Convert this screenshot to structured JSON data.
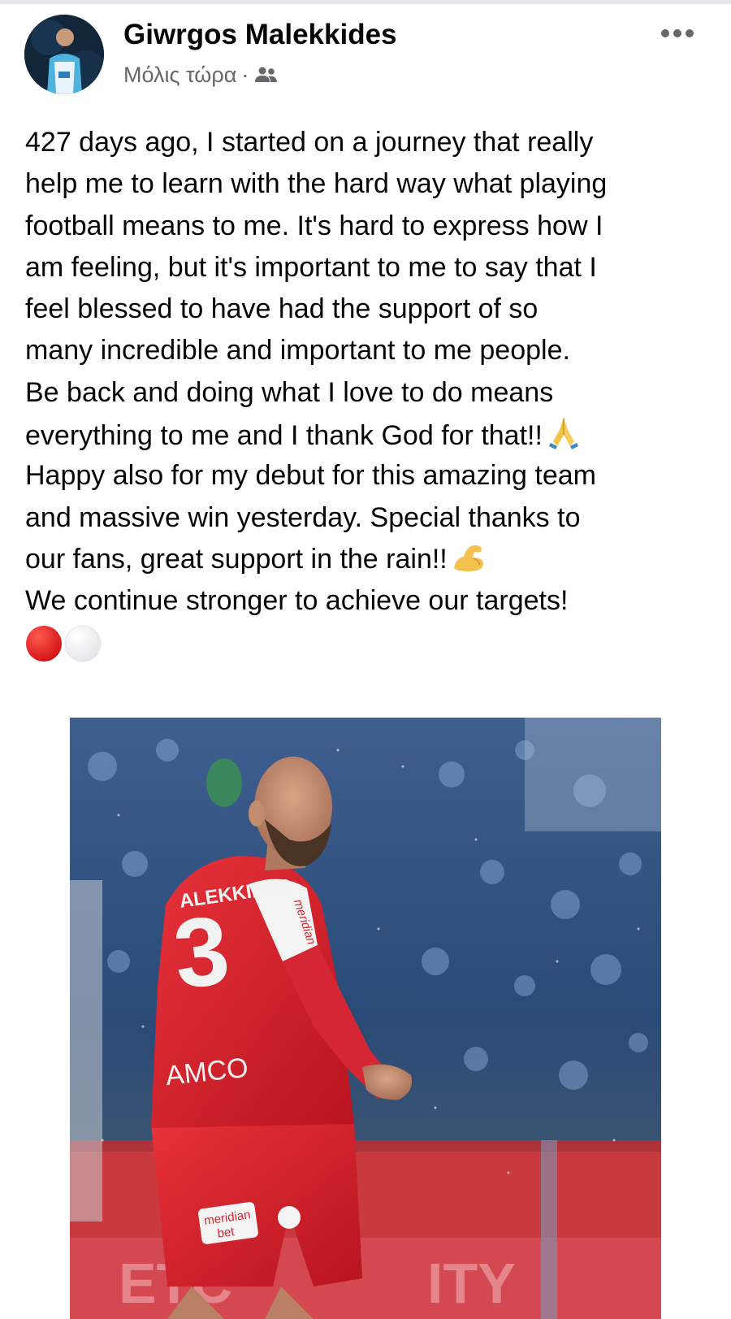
{
  "post": {
    "author": {
      "name": "Giwrgos Malekkides",
      "avatar_icon": "profile-photo"
    },
    "timestamp": "Μόλις τώρα",
    "meta_separator": "·",
    "audience_icon": "friends-icon",
    "more_icon": "more-options-icon",
    "text_lines": [
      "427 days ago, I started on a journey that really",
      "help me to learn with the hard way what playing",
      "football means to me. It's hard to express how I",
      "am feeling, but it's important to me to say that I",
      "feel blessed to have had the support of so",
      "many incredible and important to me people.",
      "Be back and doing what I love to do means",
      "everything to me and I thank God for that!!",
      "Happy also for my debut for this amazing team",
      "and massive win yesterday. Special thanks to",
      "our fans, great support in the rain!!",
      "We continue stronger to achieve our targets!"
    ],
    "emojis": {
      "line_8": "folded-hands-emoji",
      "line_11": "flexed-biceps-emoji",
      "final_line": [
        "red-circle-emoji",
        "white-circle-emoji"
      ]
    },
    "photo": {
      "description_icon": "post-photo",
      "shirt_name": "ALEKKIDES",
      "shirt_number": "3",
      "sponsor_sleeve": "meridian bet",
      "sponsor_chest": "AMCO",
      "sponsor_shorts": "meridian bet"
    }
  },
  "colors": {
    "text": "#050505",
    "secondary_text": "#65676b",
    "divider": "#e4e6eb",
    "kit_red": "#d11f2b",
    "stand_blue": "#2c4c78"
  }
}
